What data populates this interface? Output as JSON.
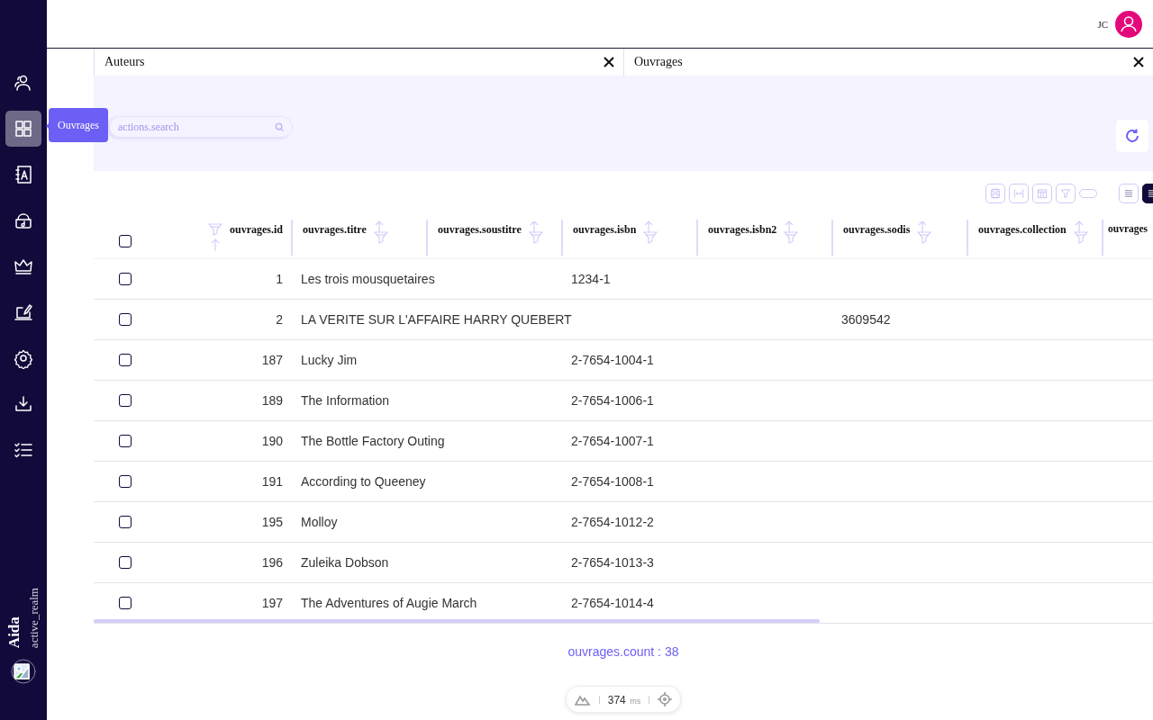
{
  "header": {
    "user_initials": "JC"
  },
  "sidebar": {
    "items": [
      {
        "kind": "users",
        "selected": false
      },
      {
        "kind": "grid",
        "selected": true
      },
      {
        "kind": "contacts",
        "selected": false
      },
      {
        "kind": "purse",
        "selected": false
      },
      {
        "kind": "crown",
        "selected": false
      },
      {
        "kind": "edit",
        "selected": false
      },
      {
        "kind": "gear",
        "selected": false
      },
      {
        "kind": "download",
        "selected": false
      },
      {
        "kind": "checklist",
        "selected": false
      }
    ],
    "tooltip": "Ouvrages",
    "app_name": "Aida",
    "realm": "active_realm"
  },
  "tabs": [
    {
      "label": "Auteurs"
    },
    {
      "label": "Ouvrages"
    }
  ],
  "search": {
    "placeholder": "actions.search"
  },
  "toolbar": {
    "tools": [
      {
        "kind": "save"
      },
      {
        "kind": "fit"
      },
      {
        "kind": "columns"
      },
      {
        "kind": "filter"
      },
      {
        "kind": "toggle",
        "on": false
      }
    ],
    "views": [
      {
        "kind": "list",
        "selected": false
      },
      {
        "kind": "list",
        "selected": true
      }
    ]
  },
  "table": {
    "select_all": {
      "checked": false
    },
    "columns": [
      {
        "label": "ouvrages.id"
      },
      {
        "label": "ouvrages.titre"
      },
      {
        "label": "ouvrages.soustitre"
      },
      {
        "label": "ouvrages.isbn"
      },
      {
        "label": "ouvrages.isbn2"
      },
      {
        "label": "ouvrages.sodis"
      },
      {
        "label": "ouvrages.collection"
      },
      {
        "label": "ouvrages"
      }
    ],
    "rows": [
      {
        "checked": false,
        "cells": [
          "1",
          "Les trois mousquetaires",
          "",
          "1234-1",
          "",
          "",
          "",
          ""
        ]
      },
      {
        "checked": false,
        "cells": [
          "2",
          "LA VERITE SUR L'AFFAIRE HARRY QUEBERT",
          "",
          "",
          "",
          "3609542",
          "",
          ""
        ]
      },
      {
        "checked": false,
        "cells": [
          "187",
          "Lucky Jim",
          "",
          "2-7654-1004-1",
          "",
          "",
          "",
          ""
        ]
      },
      {
        "checked": false,
        "cells": [
          "189",
          "The Information",
          "",
          "2-7654-1006-1",
          "",
          "",
          "",
          ""
        ]
      },
      {
        "checked": false,
        "cells": [
          "190",
          "The Bottle Factory Outing",
          "",
          "2-7654-1007-1",
          "",
          "",
          "",
          ""
        ]
      },
      {
        "checked": false,
        "cells": [
          "191",
          "According to Queeney",
          "",
          "2-7654-1008-1",
          "",
          "",
          "",
          ""
        ]
      },
      {
        "checked": false,
        "cells": [
          "195",
          "Molloy",
          "",
          "2-7654-1012-2",
          "",
          "",
          "",
          ""
        ]
      },
      {
        "checked": false,
        "cells": [
          "196",
          "Zuleika Dobson",
          "",
          "2-7654-1013-3",
          "",
          "",
          "",
          ""
        ]
      },
      {
        "checked": false,
        "cells": [
          "197",
          "The Adventures of Augie March",
          "",
          "2-7654-1014-4",
          "",
          "",
          "",
          ""
        ]
      }
    ]
  },
  "footer": {
    "count": "ouvrages.count : 38",
    "time": "374",
    "unit": "ms"
  }
}
